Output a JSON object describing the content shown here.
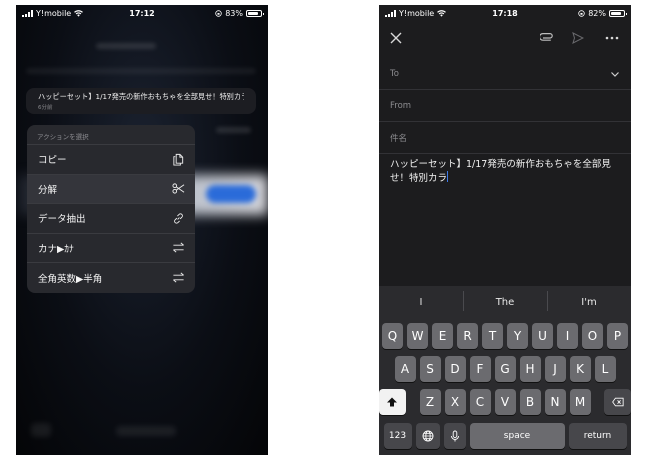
{
  "left": {
    "status": {
      "carrier": "Y!mobile",
      "time": "17:12",
      "battery": "83%",
      "battery_level": 0.83
    },
    "preview": {
      "title": "ハッピーセット】1/17発売の新作おもちゃを全部見せ！特別カラ",
      "time": "6分前"
    },
    "menu": {
      "header": "アクションを選択",
      "items": [
        {
          "label": "コピー",
          "icon": "copy-icon"
        },
        {
          "label": "分解",
          "icon": "scissors-icon"
        },
        {
          "label": "データ抽出",
          "icon": "link-icon"
        },
        {
          "label": "カナ▶ｶﾅ",
          "icon": "swap-arrows-icon"
        },
        {
          "label": "全角英数▶半角",
          "icon": "swap-arrows-icon"
        }
      ]
    }
  },
  "right": {
    "status": {
      "carrier": "Y!mobile",
      "time": "17:18",
      "battery": "82%",
      "battery_level": 0.82
    },
    "compose": {
      "to_label": "To",
      "from_label": "From",
      "subject_placeholder": "件名",
      "body": "ハッピーセット】1/17発売の新作おもちゃを全部見せ！特別カラ"
    },
    "keyboard": {
      "suggestions": [
        "I",
        "The",
        "I'm"
      ],
      "row1": [
        "Q",
        "W",
        "E",
        "R",
        "T",
        "Y",
        "U",
        "I",
        "O",
        "P"
      ],
      "row2": [
        "A",
        "S",
        "D",
        "F",
        "G",
        "H",
        "J",
        "K",
        "L"
      ],
      "row3": [
        "Z",
        "X",
        "C",
        "V",
        "B",
        "N",
        "M"
      ],
      "numbers_key": "123",
      "space_key": "space",
      "return_key": "return"
    }
  }
}
